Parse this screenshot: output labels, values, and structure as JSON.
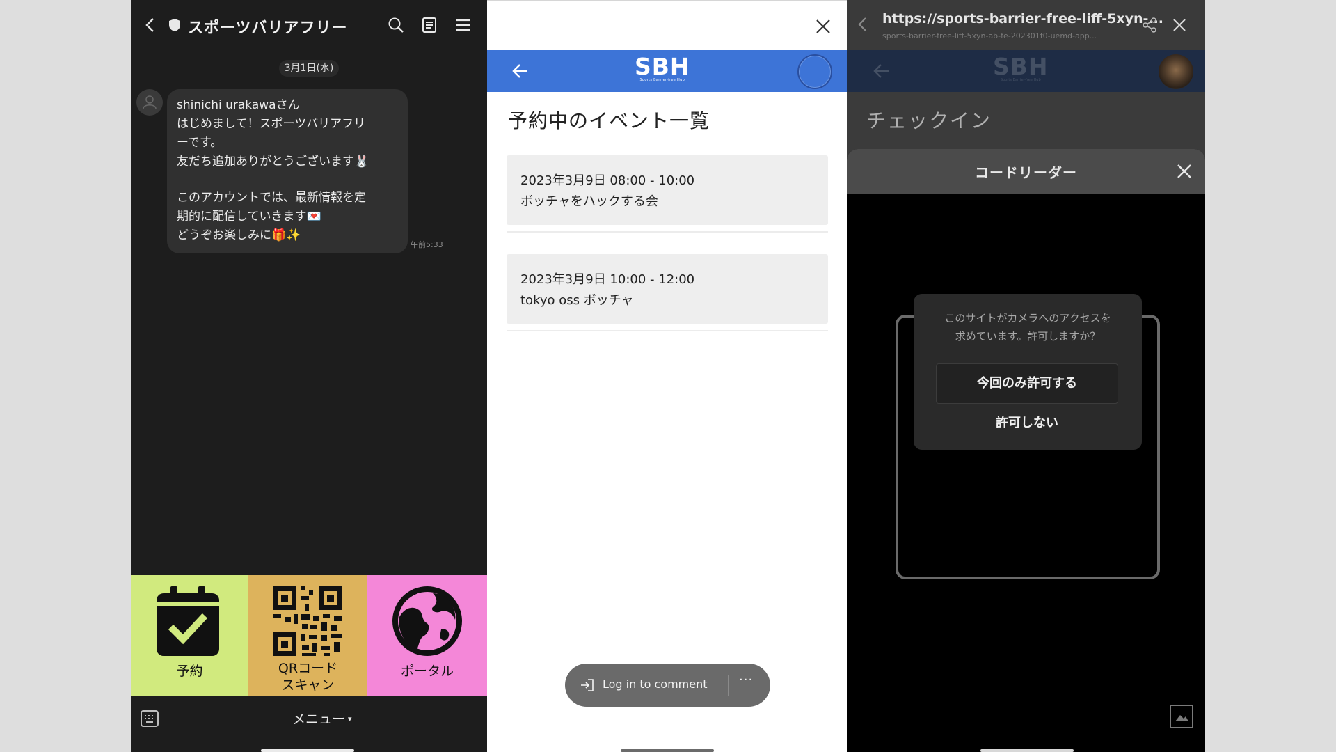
{
  "line_chat": {
    "header": {
      "title": "スポーツバリアフリー",
      "back_icon": "chevron-left-icon",
      "shield_icon": "shield-icon",
      "search_icon": "search-icon",
      "notes_icon": "notes-icon",
      "menu_icon": "hamburger-menu-icon"
    },
    "date_label": "3月1日(水)",
    "message": {
      "lines": [
        "shinichi urakawaさん",
        "はじめまして！スポーツバリアフリ",
        "ーです。",
        "友だち追加ありがとうございます🐰",
        "このアカウントでは、最新情報を定",
        "期的に配信していきます💌",
        "どうぞお楽しみに🎁✨"
      ],
      "time": "午前5:33"
    },
    "rich_menu": {
      "items": [
        {
          "label_lines": [
            "予約"
          ],
          "icon": "calendar-check-icon",
          "color": "#d1ea7e"
        },
        {
          "label_lines": [
            "QRコード",
            "スキャン"
          ],
          "icon": "qr-code-icon",
          "color": "#ddb35c"
        },
        {
          "label_lines": [
            "ポータル"
          ],
          "icon": "globe-icon",
          "color": "#f487d8"
        }
      ]
    },
    "bottom": {
      "keyboard_icon": "keyboard-icon",
      "menu_label": "メニュー",
      "menu_caret": "▾"
    }
  },
  "events_panel": {
    "close_icon": "close-icon",
    "app_bar": {
      "color": "#3d74d7",
      "back_icon": "arrow-left-icon",
      "logo_text": "SBH",
      "logo_subtext": "Sports Barrier-free Hub",
      "profile_icon": "profile-circle-icon"
    },
    "title": "予約中のイベント一覧",
    "events": [
      {
        "datetime": "2023年3月9日 08:00 - 10:00",
        "name": "ボッチャをハックする会"
      },
      {
        "datetime": "2023年3月9日 10:00 - 12:00",
        "name": "tokyo oss ボッチャ"
      }
    ],
    "comment_pill": {
      "login_icon": "login-icon",
      "label": "Log in to comment",
      "more": "···"
    }
  },
  "checkin_panel": {
    "browser": {
      "url": "https://sports-barrier-free-liff-5xyn-...",
      "sub_url": "sports-barrier-free-liff-5xyn-ab-fe-202301f0-uemd-app...",
      "back_icon": "chevron-left-icon",
      "share_icon": "share-icon",
      "close_icon": "close-icon"
    },
    "app_bar": {
      "logo_text": "SBH",
      "logo_subtext": "Sports Barrier-free Hub"
    },
    "title": "チェックイン",
    "code_reader": {
      "title": "コードリーダー",
      "close_icon": "close-icon"
    },
    "permission_dialog": {
      "question_lines": [
        "このサイトがカメラへのアクセスを",
        "求めています。許可しますか？"
      ],
      "allow_once": "今回のみ許可する",
      "deny": "許可しない"
    },
    "image_icon": "image-icon"
  }
}
